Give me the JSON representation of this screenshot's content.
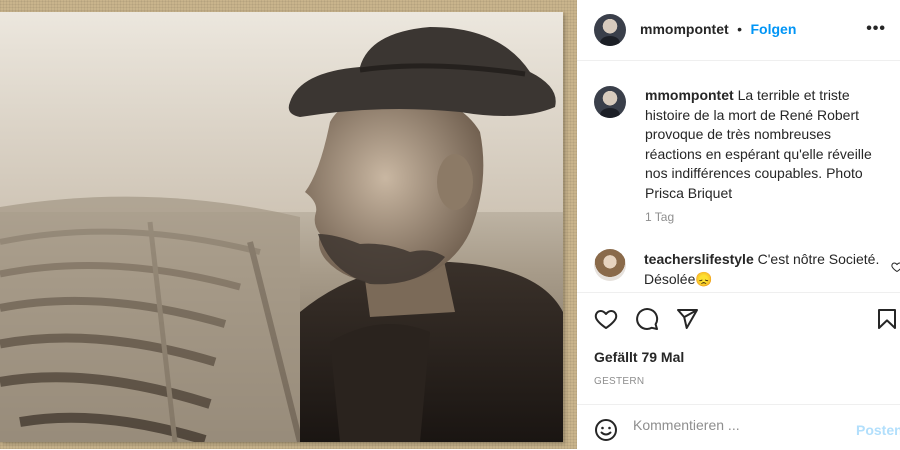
{
  "post": {
    "username": "mmompontet",
    "separator": "•",
    "follow_label": "Folgen",
    "more_icon": "more-horizontal-icon",
    "more_label": "•••"
  },
  "caption": {
    "username": "mmompontet",
    "text": "La terrible et triste histoire de la mort de René Robert provoque de très nombreuses réactions en espérant qu'elle réveille nos indifférences coupables. Photo Prisca Briquet",
    "time": "1 Tag"
  },
  "comments": [
    {
      "username": "teacherslifestyle",
      "text": "C'est nôtre Societé. Désolée😞"
    }
  ],
  "actions": {
    "like_icon": "heart-icon",
    "comment_icon": "comment-icon",
    "share_icon": "paper-plane-icon",
    "save_icon": "bookmark-icon"
  },
  "likes_label": "Gefällt 79 Mal",
  "date_label": "GESTERN",
  "comment_box": {
    "placeholder": "Kommentieren ...",
    "post_label": "Posten",
    "emoji_icon": "smiley-icon"
  },
  "colors": {
    "accent": "#0095f6",
    "post_disabled": "#b2dffc",
    "muted": "#8e8e8e",
    "text": "#262626",
    "divider": "#efefef"
  }
}
